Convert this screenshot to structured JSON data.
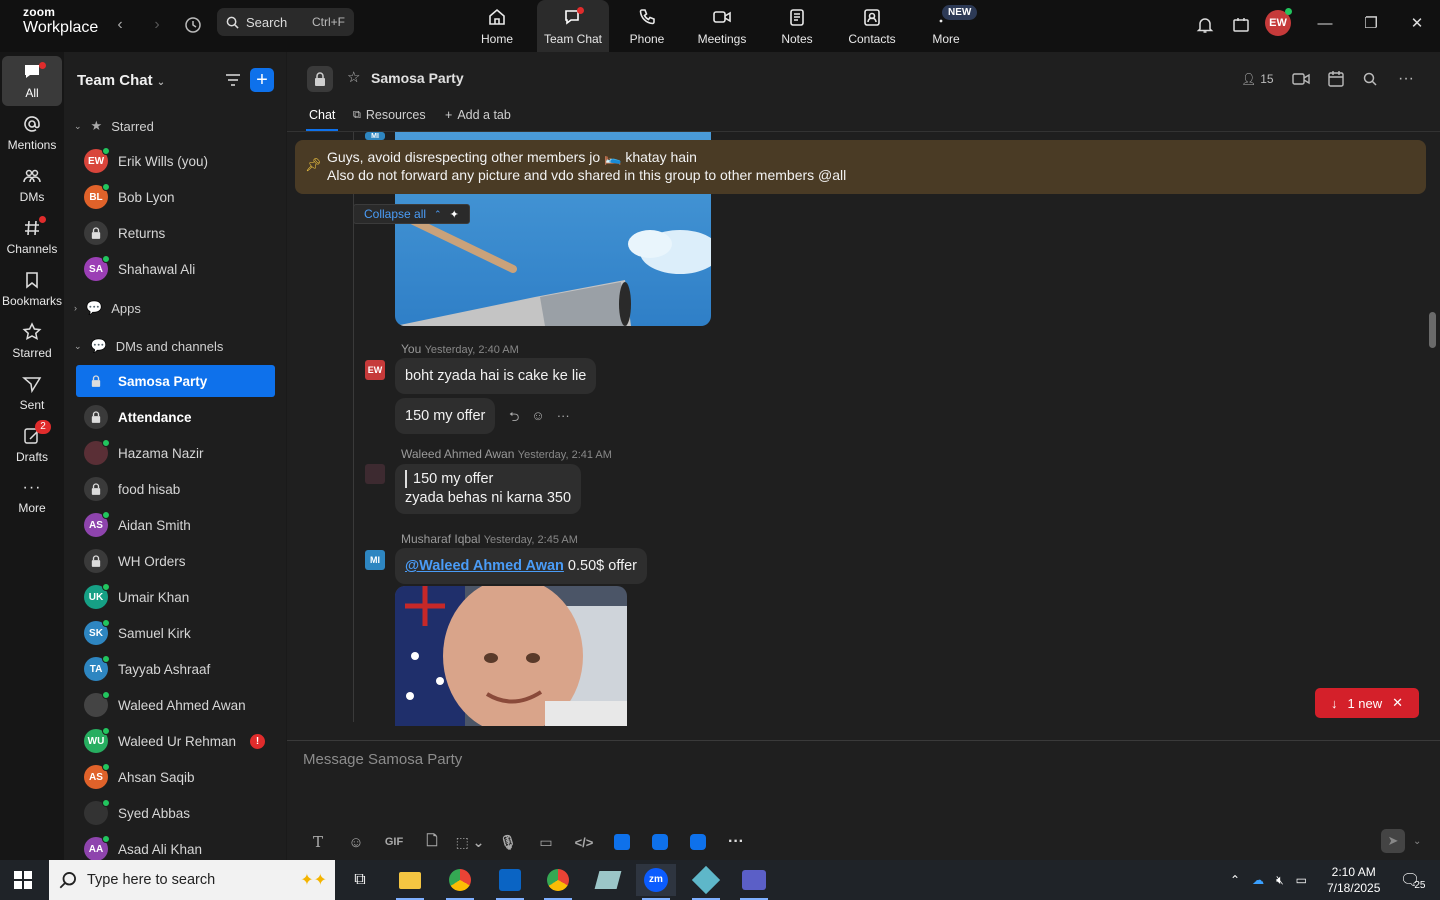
{
  "app": {
    "logo_top": "zoom",
    "logo_bottom": "Workplace"
  },
  "topbar": {
    "search_label": "Search",
    "search_shortcut": "Ctrl+F",
    "tabs": [
      {
        "label": "Home"
      },
      {
        "label": "Team Chat"
      },
      {
        "label": "Phone"
      },
      {
        "label": "Meetings"
      },
      {
        "label": "Notes"
      },
      {
        "label": "Contacts"
      },
      {
        "label": "More"
      }
    ],
    "new_badge": "NEW",
    "user_initials": "EW"
  },
  "rail": {
    "items": [
      {
        "label": "All"
      },
      {
        "label": "Mentions"
      },
      {
        "label": "DMs"
      },
      {
        "label": "Channels"
      },
      {
        "label": "Bookmarks"
      },
      {
        "label": "Starred"
      },
      {
        "label": "Sent"
      },
      {
        "label": "Drafts",
        "badge": "2"
      },
      {
        "label": "More"
      }
    ]
  },
  "sidebar": {
    "title": "Team Chat",
    "starred_label": "Starred",
    "starred": [
      {
        "name": "Erik Wills (you)",
        "initials": "EW",
        "color": "#d9453b"
      },
      {
        "name": "Bob Lyon",
        "initials": "BL",
        "color": "#e0622a"
      },
      {
        "name": "Returns",
        "lock": true
      },
      {
        "name": "Shahawal Ali",
        "initials": "SA",
        "color": "#9b3fb5"
      }
    ],
    "apps_label": "Apps",
    "dms_label": "DMs and channels",
    "dms": [
      {
        "name": "Samosa Party",
        "lock": true
      },
      {
        "name": "Attendance",
        "lock": true
      },
      {
        "name": "Hazama Nazir",
        "initials": "",
        "color": "#5a2f36"
      },
      {
        "name": "food hisab",
        "lock": true
      },
      {
        "name": "Aidan Smith",
        "initials": "AS",
        "color": "#8e44ad"
      },
      {
        "name": "WH Orders",
        "lock": true
      },
      {
        "name": "Umair Khan",
        "initials": "UK",
        "color": "#16a085"
      },
      {
        "name": "Samuel Kirk",
        "initials": "SK",
        "color": "#2e86c1"
      },
      {
        "name": "Tayyab Ashraaf",
        "initials": "TA",
        "color": "#2e86c1"
      },
      {
        "name": "Waleed Ahmed Awan",
        "initials": "",
        "color": "#444"
      },
      {
        "name": "Waleed Ur Rehman",
        "initials": "WU",
        "color": "#27ae60",
        "alert": "!"
      },
      {
        "name": "Ahsan Saqib",
        "initials": "AS",
        "color": "#e0622a"
      },
      {
        "name": "Syed Abbas",
        "initials": "",
        "color": "#333"
      },
      {
        "name": "Asad Ali Khan",
        "initials": "AA",
        "color": "#8e44ad"
      }
    ]
  },
  "channel": {
    "name": "Samosa Party",
    "member_count": "15",
    "tabs": {
      "chat": "Chat",
      "resources": "Resources",
      "add": "Add a tab"
    },
    "pinned_line1": "Guys, avoid disrespecting other members jo 🛌 khatay hain",
    "pinned_line2": "Also do not forward any picture and vdo shared in this group to other members @all",
    "collapse_label": "Collapse all",
    "top_avatar": "MI"
  },
  "messages": [
    {
      "sender": "You",
      "time": "Yesterday, 2:40 AM",
      "avatar": "EW",
      "texts": [
        "boht zyada hai is cake ke lie",
        "150 my offer"
      ]
    },
    {
      "sender": "Waleed Ahmed Awan",
      "time": "Yesterday, 2:41 AM",
      "quote": "150 my offer",
      "text": "zyada behas ni karna 350"
    },
    {
      "sender": "Musharaf Iqbal",
      "time": "Yesterday, 2:45 AM",
      "avatar": "MI",
      "mention": "@Waleed Ahmed Awan",
      "text": " 0.50$ offer"
    }
  ],
  "new_pill": "1 new",
  "composer": {
    "placeholder": "Message Samosa Party",
    "gif": "GIF"
  },
  "taskbar": {
    "search_placeholder": "Type here to search",
    "time": "2:10 AM",
    "date": "7/18/2025",
    "notif": "25"
  }
}
